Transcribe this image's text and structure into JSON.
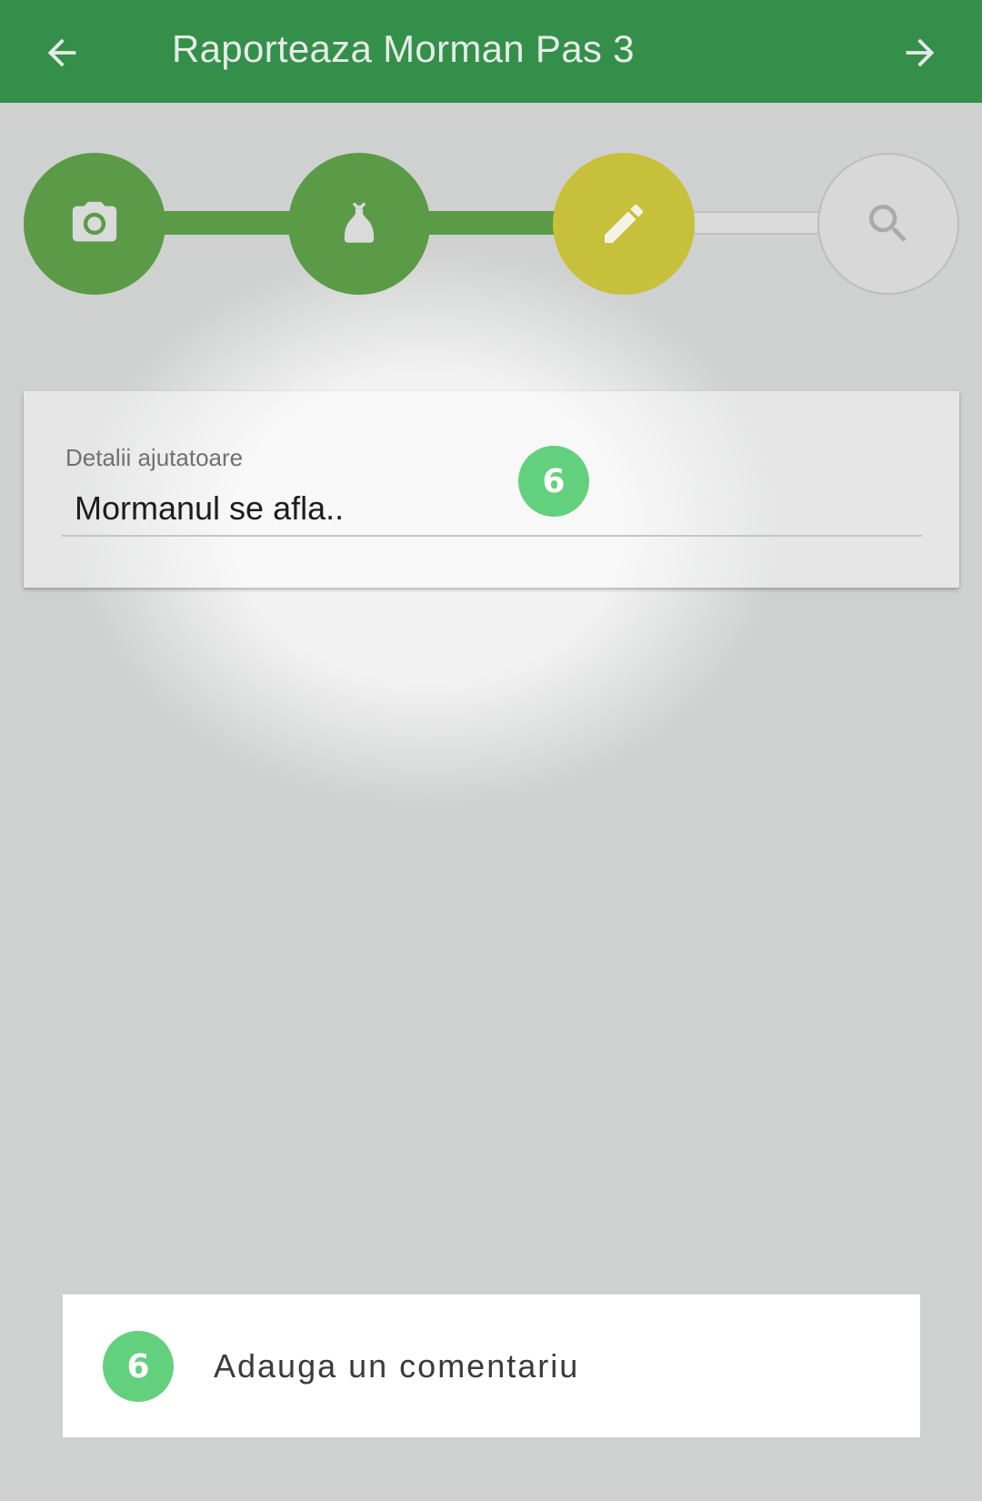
{
  "appbar": {
    "title": "Raporteaza Morman Pas 3",
    "back_icon": "arrow-left-icon",
    "forward_icon": "arrow-right-icon",
    "color": "#348f4b"
  },
  "stepper": {
    "steps": [
      {
        "icon": "camera-icon",
        "state": "done"
      },
      {
        "icon": "trash-bag-icon",
        "state": "done"
      },
      {
        "icon": "pencil-icon",
        "state": "current"
      },
      {
        "icon": "search-icon",
        "state": "todo"
      }
    ],
    "colors": {
      "done": "#5b9a47",
      "current": "#c6c03a",
      "todo": "#d7d8d7"
    }
  },
  "details": {
    "label": "Detalii ajutatoare",
    "placeholder": "Mormanul se afla..",
    "value": "",
    "badge": "6"
  },
  "comment": {
    "badge": "6",
    "label": "Adauga un comentariu"
  },
  "badge_color": "#63d07d"
}
